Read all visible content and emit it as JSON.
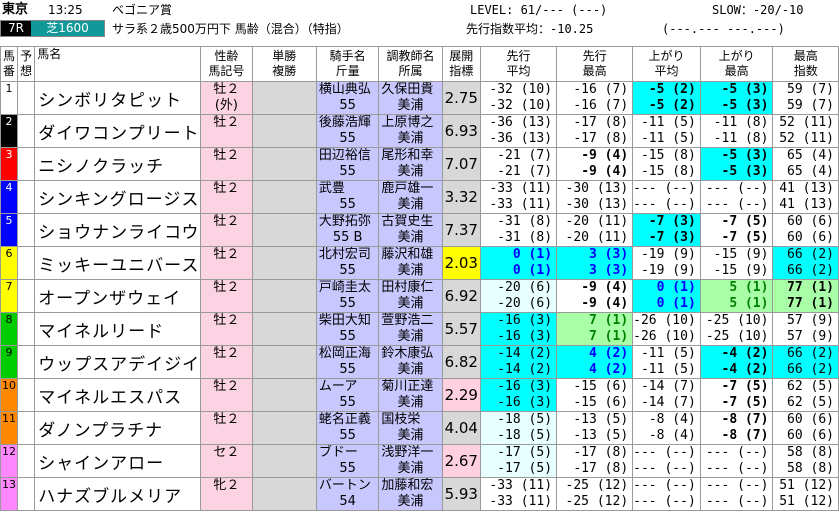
{
  "header": {
    "track": "東京",
    "time": "13:25",
    "race_name": "ベゴニア賞",
    "race_no": "7R",
    "course": "芝1600",
    "cond": "サラ系２歳500万円下 馬齢（混合）（特指）",
    "level": "LEVEL: 61/--- (---)",
    "slow": "SLOW：-20/-10",
    "senko": "先行指数平均：-10.25",
    "senko_rest": "(---.--- ---.---)"
  },
  "columns": {
    "uma": "馬",
    "ban": "番",
    "yo": "予",
    "so": "想",
    "bamei": "馬名",
    "seirei": "性齢",
    "bakigo": "馬記号",
    "tansho": "単勝",
    "fukusho": "複勝",
    "kishu": "騎手名",
    "kinryo": "斤量",
    "chokyo": "調教師名",
    "shozoku": "所属",
    "tenkai": "展開",
    "shihyo": "指標",
    "sk_a1": "先行",
    "sk_a2": "平均",
    "sk_m1": "先行",
    "sk_m2": "最高",
    "ag_a1": "上がり",
    "ag_a2": "平均",
    "ag_m1": "上がり",
    "ag_m2": "最高",
    "mx1": "最高",
    "mx2": "指数"
  },
  "colors": {
    "waku": [
      "#ffffff",
      "#000000",
      "#ff0000",
      "#0000ff",
      "#ffff00",
      "#00aa00",
      "#ff8800",
      "#ff88ff"
    ]
  },
  "horses": [
    {
      "no": "1",
      "name": "シンボリタピット",
      "sex": "牡２",
      "sex2": "(外)",
      "jockey": "横山典弘",
      "weight": "55",
      "trainer": "久保田貴",
      "loc": "美浦",
      "tenkai": "2.75",
      "sa": [
        "-32 (10)",
        "-32 (10)"
      ],
      "sm": [
        "-16 (7)",
        "-16 (7)"
      ],
      "aa": [
        "-5 (2)",
        "-5 (2)"
      ],
      "am": [
        "-5 (3)",
        "-5 (3)"
      ],
      "mx": [
        "59 (7)",
        "59 (7)"
      ]
    },
    {
      "no": "2",
      "name": "ダイワコンプリート",
      "sex": "牡２",
      "sex2": "",
      "jockey": "後藤浩輝",
      "weight": "55",
      "trainer": "上原博之",
      "loc": "美浦",
      "tenkai": "6.93",
      "sa": [
        "-36 (13)",
        "-36 (13)"
      ],
      "sm": [
        "-17 (8)",
        "-17 (8)"
      ],
      "aa": [
        "-11 (5)",
        "-11 (5)"
      ],
      "am": [
        "-11 (8)",
        "-11 (8)"
      ],
      "mx": [
        "52 (11)",
        "52 (11)"
      ]
    },
    {
      "no": "3",
      "name": "ニシノクラッチ",
      "sex": "牡２",
      "sex2": "",
      "jockey": "田辺裕信",
      "weight": "55",
      "trainer": "尾形和幸",
      "loc": "美浦",
      "tenkai": "7.07",
      "sa": [
        "-21 (7)",
        "-21 (7)"
      ],
      "sm": [
        "-9 (4)",
        "-9 (4)"
      ],
      "aa": [
        "-15 (8)",
        "-15 (8)"
      ],
      "am": [
        "-5 (3)",
        "-5 (3)"
      ],
      "mx": [
        "65 (4)",
        "65 (4)"
      ]
    },
    {
      "no": "4",
      "name": "シンキングロージス",
      "sex": "牡２",
      "sex2": "",
      "jockey": "武豊",
      "weight": "55",
      "trainer": "鹿戸雄一",
      "loc": "美浦",
      "tenkai": "3.32",
      "sa": [
        "-33 (11)",
        "-33 (11)"
      ],
      "sm": [
        "-30 (13)",
        "-30 (13)"
      ],
      "aa": [
        "--- (--)",
        "--- (--)"
      ],
      "am": [
        "--- (--)",
        "--- (--)"
      ],
      "mx": [
        "41 (13)",
        "41 (13)"
      ]
    },
    {
      "no": "5",
      "name": "ショウナンライコウ",
      "sex": "牡２",
      "sex2": "",
      "jockey": "大野拓弥",
      "weight": "55 B",
      "trainer": "古賀史生",
      "loc": "美浦",
      "tenkai": "7.37",
      "sa": [
        "-31 (8)",
        "-31 (8)"
      ],
      "sm": [
        "-20 (11)",
        "-20 (11)"
      ],
      "aa": [
        "-7 (3)",
        "-7 (3)"
      ],
      "am": [
        "-7 (5)",
        "-7 (5)"
      ],
      "mx": [
        "60 (6)",
        "60 (6)"
      ]
    },
    {
      "no": "6",
      "name": "ミッキーユニバース",
      "sex": "牡２",
      "sex2": "",
      "jockey": "北村宏司",
      "weight": "55",
      "trainer": "藤沢和雄",
      "loc": "美浦",
      "tenkai": "2.03",
      "sa": [
        "0 (1)",
        "0 (1)"
      ],
      "sm": [
        "3 (3)",
        "3 (3)"
      ],
      "aa": [
        "-19 (9)",
        "-19 (9)"
      ],
      "am": [
        "-15 (9)",
        "-15 (9)"
      ],
      "mx": [
        "66 (2)",
        "66 (2)"
      ]
    },
    {
      "no": "7",
      "name": "オープンザウェイ",
      "sex": "牡２",
      "sex2": "",
      "jockey": "戸崎圭太",
      "weight": "55",
      "trainer": "田村康仁",
      "loc": "美浦",
      "tenkai": "6.92",
      "sa": [
        "-20 (6)",
        "-20 (6)"
      ],
      "sm": [
        "-9 (4)",
        "-9 (4)"
      ],
      "aa": [
        "0 (1)",
        "0 (1)"
      ],
      "am": [
        "5 (1)",
        "5 (1)"
      ],
      "mx": [
        "77 (1)",
        "77 (1)"
      ]
    },
    {
      "no": "8",
      "name": "マイネルリード",
      "sex": "牡２",
      "sex2": "",
      "jockey": "柴田大知",
      "weight": "55",
      "trainer": "萱野浩二",
      "loc": "美浦",
      "tenkai": "5.57",
      "sa": [
        "-16 (3)",
        "-16 (3)"
      ],
      "sm": [
        "7 (1)",
        "7 (1)"
      ],
      "aa": [
        "-26 (10)",
        "-26 (10)"
      ],
      "am": [
        "-25 (10)",
        "-25 (10)"
      ],
      "mx": [
        "57 (9)",
        "57 (9)"
      ]
    },
    {
      "no": "9",
      "name": "ウップスアデイジイ",
      "sex": "牡２",
      "sex2": "",
      "jockey": "松岡正海",
      "weight": "55",
      "trainer": "鈴木康弘",
      "loc": "美浦",
      "tenkai": "6.82",
      "sa": [
        "-14 (2)",
        "-14 (2)"
      ],
      "sm": [
        "4 (2)",
        "4 (2)"
      ],
      "aa": [
        "-11 (5)",
        "-11 (5)"
      ],
      "am": [
        "-4 (2)",
        "-4 (2)"
      ],
      "mx": [
        "66 (2)",
        "66 (2)"
      ]
    },
    {
      "no": "10",
      "name": "マイネルエスパス",
      "sex": "牡２",
      "sex2": "",
      "jockey": "ムーア",
      "weight": "55",
      "trainer": "菊川正達",
      "loc": "美浦",
      "tenkai": "2.29",
      "sa": [
        "-16 (3)",
        "-16 (3)"
      ],
      "sm": [
        "-15 (6)",
        "-15 (6)"
      ],
      "aa": [
        "-14 (7)",
        "-14 (7)"
      ],
      "am": [
        "-7 (5)",
        "-7 (5)"
      ],
      "mx": [
        "62 (5)",
        "62 (5)"
      ]
    },
    {
      "no": "11",
      "name": "ダノンプラチナ",
      "sex": "牡２",
      "sex2": "",
      "jockey": "蛯名正義",
      "weight": "55",
      "trainer": "国枝栄",
      "loc": "美浦",
      "tenkai": "4.04",
      "sa": [
        "-18 (5)",
        "-18 (5)"
      ],
      "sm": [
        "-13 (5)",
        "-13 (5)"
      ],
      "aa": [
        "-8 (4)",
        "-8 (4)"
      ],
      "am": [
        "-8 (7)",
        "-8 (7)"
      ],
      "mx": [
        "60 (6)",
        "60 (6)"
      ]
    },
    {
      "no": "12",
      "name": "シャインアロー",
      "sex": "セ２",
      "sex2": "",
      "jockey": "ブドー",
      "weight": "55",
      "trainer": "浅野洋一",
      "loc": "美浦",
      "tenkai": "2.67",
      "sa": [
        "-17 (5)",
        "-17 (5)"
      ],
      "sm": [
        "-17 (8)",
        "-17 (8)"
      ],
      "aa": [
        "--- (--)",
        "--- (--)"
      ],
      "am": [
        "--- (--)",
        "--- (--)"
      ],
      "mx": [
        "58 (8)",
        "58 (8)"
      ]
    },
    {
      "no": "13",
      "name": "ハナズブルメリア",
      "sex": "牝２",
      "sex2": "",
      "jockey": "バートン",
      "weight": "54",
      "trainer": "加藤和宏",
      "loc": "美浦",
      "tenkai": "5.93",
      "sa": [
        "-33 (11)",
        "-33 (11)"
      ],
      "sm": [
        "-25 (12)",
        "-25 (12)"
      ],
      "aa": [
        "--- (--)",
        "--- (--)"
      ],
      "am": [
        "--- (--)",
        "--- (--)"
      ],
      "mx": [
        "51 (12)",
        "51 (12)"
      ]
    }
  ]
}
